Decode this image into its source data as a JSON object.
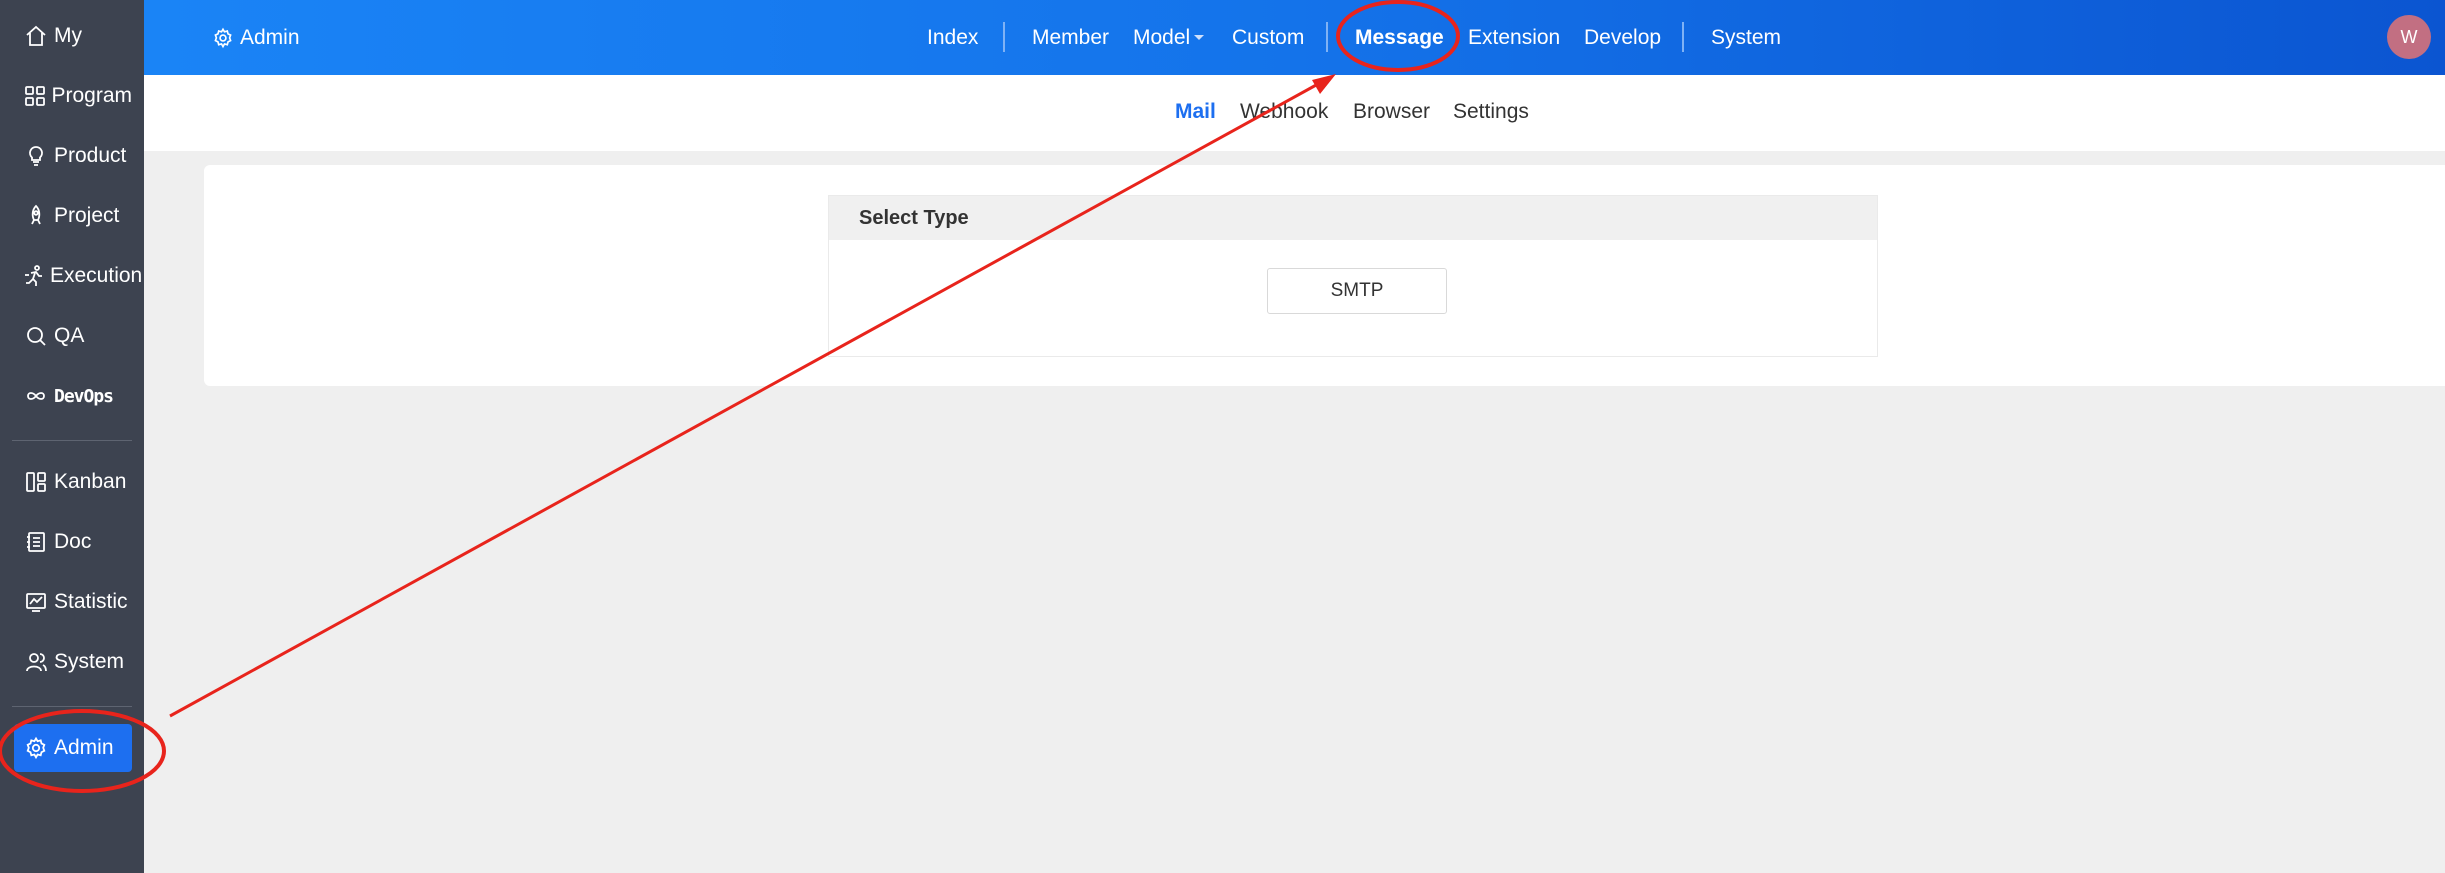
{
  "sidebar": {
    "items": [
      {
        "label": "My",
        "icon": "home-icon"
      },
      {
        "label": "Program",
        "icon": "grid-icon"
      },
      {
        "label": "Product",
        "icon": "bulb-icon"
      },
      {
        "label": "Project",
        "icon": "rocket-icon"
      },
      {
        "label": "Execution",
        "icon": "run-icon"
      },
      {
        "label": "QA",
        "icon": "search-icon"
      },
      {
        "label": "DevOps",
        "icon": "infinity-icon"
      },
      {
        "label": "Kanban",
        "icon": "kanban-icon"
      },
      {
        "label": "Doc",
        "icon": "doc-icon"
      },
      {
        "label": "Statistic",
        "icon": "chart-icon"
      },
      {
        "label": "System",
        "icon": "users-icon"
      },
      {
        "label": "Admin",
        "icon": "gear-icon"
      }
    ],
    "active": "Admin"
  },
  "topbar": {
    "brand": "Admin",
    "nav": [
      "Index",
      "Member",
      "Model",
      "Custom",
      "Message",
      "Extension",
      "Develop",
      "System"
    ],
    "active": "Message",
    "avatar": "W"
  },
  "subnav": {
    "items": [
      "Mail",
      "Webhook",
      "Browser",
      "Settings"
    ],
    "active": "Mail"
  },
  "panel": {
    "header": "Select Type",
    "button": "SMTP"
  },
  "colors": {
    "accent": "#1d6ff0",
    "sidebar_bg": "#3d4350",
    "annotation": "#e8241c"
  }
}
